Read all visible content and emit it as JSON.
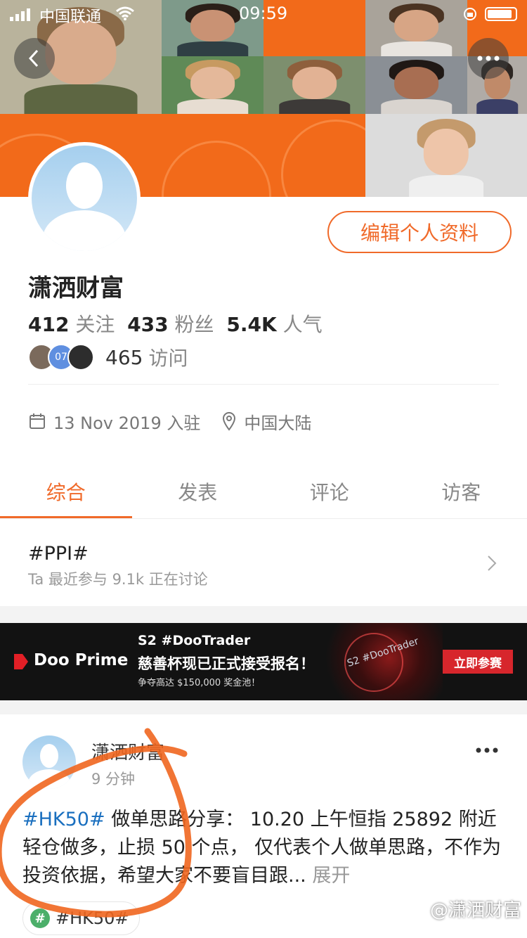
{
  "status_bar": {
    "carrier": "中国联通",
    "time": "09:59"
  },
  "profile": {
    "name": "潇洒财富",
    "edit_button": "编辑个人资料",
    "stats": [
      {
        "value": "412",
        "label": "关注"
      },
      {
        "value": "433",
        "label": "粉丝"
      },
      {
        "value": "5.4K",
        "label": "人气"
      }
    ],
    "visitor_badge": "07",
    "visits_count": "465",
    "visits_label": "访问",
    "join_date": "13 Nov 2019 入驻",
    "location": "中国大陆"
  },
  "tabs": [
    "综合",
    "发表",
    "评论",
    "访客"
  ],
  "topic": {
    "title": "#PPI#",
    "meta": "Ta 最近参与  9.1k 正在讨论"
  },
  "banner": {
    "brand": "Doo Prime",
    "line1": "S2 #DooTrader",
    "line2": "慈善杯现已正式接受报名！",
    "line3": "争夺高达 $150,000 奖金池！",
    "art_text": "S2 #DooTrader",
    "cta": "立即参赛"
  },
  "post": {
    "author": "潇洒财富",
    "time": "9 分钟",
    "hashtag": "#HK50#",
    "body": " 做单思路分享： 10.20 上午恒指 25892 附近轻仓做多，止损 50 个点， 仅代表个人做单思路，不作为投资依据，希望大家不要盲目跟...",
    "expand": "展开",
    "tag": "#HK50#"
  },
  "watermark": "@潇洒财富",
  "colors": {
    "accent": "#f06a2a",
    "cover": "#f26a1a",
    "banner_bg": "#121212",
    "cta_red": "#d7262c"
  },
  "icons": [
    "back-arrow-icon",
    "more-dots-icon",
    "calendar-icon",
    "location-pin-icon",
    "chevron-right-icon",
    "hashtag-icon",
    "wifi-icon",
    "signal-icon",
    "battery-icon"
  ]
}
